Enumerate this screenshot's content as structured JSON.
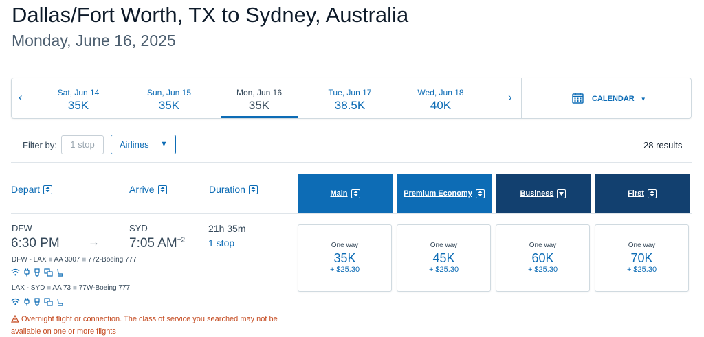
{
  "header": {
    "title": "Dallas/Fort Worth, TX to Sydney, Australia",
    "subtitle": "Monday, June 16, 2025"
  },
  "date_bar": {
    "prev_icon": "chevron-left-icon",
    "next_icon": "chevron-right-icon",
    "dates": [
      {
        "day": "Sat, Jun 14",
        "price": "35K",
        "selected": false
      },
      {
        "day": "Sun, Jun 15",
        "price": "35K",
        "selected": false
      },
      {
        "day": "Mon, Jun 16",
        "price": "35K",
        "selected": true
      },
      {
        "day": "Tue, Jun 17",
        "price": "38.5K",
        "selected": false
      },
      {
        "day": "Wed, Jun 18",
        "price": "40K",
        "selected": false
      }
    ],
    "calendar_label": "CALENDAR",
    "calendar_icon": "calendar-icon"
  },
  "filters": {
    "label": "Filter by:",
    "stop_filter": "1 stop",
    "airlines_label": "Airlines",
    "results": "28 results"
  },
  "columns": {
    "depart": "Depart",
    "arrive": "Arrive",
    "duration": "Duration",
    "cabins": [
      {
        "label": "Main",
        "color": "#0d6cb5"
      },
      {
        "label": "Premium Economy",
        "color": "#0d6cb5"
      },
      {
        "label": "Business",
        "color": "#12406f"
      },
      {
        "label": "First",
        "color": "#12406f"
      }
    ]
  },
  "flight": {
    "origin": "DFW",
    "depart_time": "6:30 PM",
    "destination": "SYD",
    "arrive_time": "7:05 AM",
    "day_offset": "+2",
    "duration": "21h 35m",
    "stops": "1 stop",
    "legs": [
      {
        "route": "DFW - LAX",
        "flight": "AA 3007",
        "aircraft": "772-Boeing 777"
      },
      {
        "route": "LAX - SYD",
        "flight": "AA 73",
        "aircraft": "77W-Boeing 777"
      }
    ],
    "amenities": [
      "wifi-icon",
      "power-icon",
      "usb-icon",
      "entertainment-icon",
      "seat-icon"
    ],
    "fares": [
      {
        "type": "One way",
        "points": "35K",
        "tax": "+ $25.30"
      },
      {
        "type": "One way",
        "points": "45K",
        "tax": "+ $25.30"
      },
      {
        "type": "One way",
        "points": "60K",
        "tax": "+ $25.30"
      },
      {
        "type": "One way",
        "points": "70K",
        "tax": "+ $25.30"
      }
    ],
    "warning": "Overnight flight or connection. The class of service you searched may not be available on one or more flights",
    "warning_color": "#c4491f"
  }
}
